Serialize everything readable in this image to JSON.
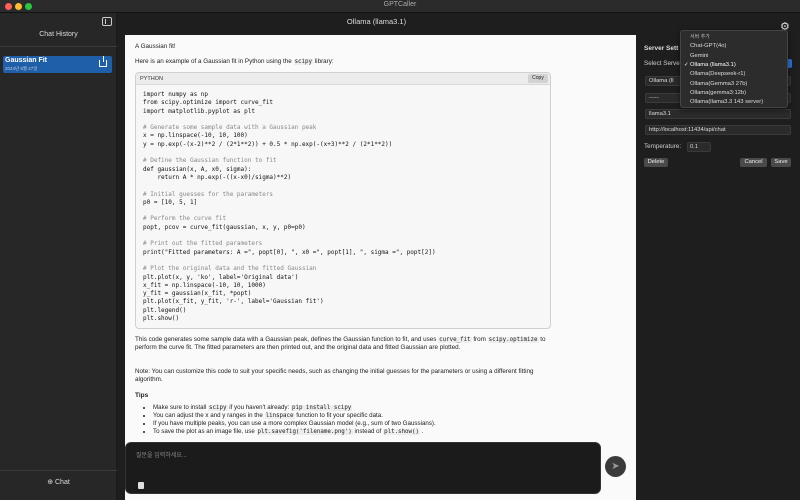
{
  "window": {
    "title": "GPTCaller"
  },
  "sidebar": {
    "title": "Chat History",
    "items": [
      {
        "title": "Gaussian Fit",
        "subtitle": "2024년 9월 27일"
      }
    ],
    "chat_button": "Chat"
  },
  "header": {
    "model_title": "Ollama (llama3.1)"
  },
  "message": {
    "user_prompt": "A Gaussian fit!",
    "intro_before": "Here is an example of a Gaussian fit in Python using the",
    "intro_code": "scipy",
    "intro_after": "library:",
    "code": {
      "language": "PYTHON",
      "copy_label": "Copy",
      "lines": [
        "import numpy as np",
        "from scipy.optimize import curve_fit",
        "import matplotlib.pyplot as plt",
        "",
        "# Generate some sample data with a Gaussian peak",
        "x = np.linspace(-10, 10, 100)",
        "y = np.exp(-(x-2)**2 / (2*1**2)) + 0.5 * np.exp(-(x+3)**2 / (2*1**2))",
        "",
        "# Define the Gaussian function to fit",
        "def gaussian(x, A, x0, sigma):",
        "    return A * np.exp(-((x-x0)/sigma)**2)",
        "",
        "# Initial guesses for the parameters",
        "p0 = [10, 5, 1]",
        "",
        "# Perform the curve fit",
        "popt, pcov = curve_fit(gaussian, x, y, p0=p0)",
        "",
        "# Print out the fitted parameters",
        "print(\"Fitted parameters: A =\", popt[0], \", x0 =\", popt[1], \", sigma =\", popt[2])",
        "",
        "# Plot the original data and the fitted Gaussian",
        "plt.plot(x, y, 'ko', label='Original data')",
        "x_fit = np.linspace(-10, 10, 1000)",
        "y_fit = gaussian(x_fit, *popt)",
        "plt.plot(x_fit, y_fit, 'r-', label='Gaussian fit')",
        "plt.legend()",
        "plt.show()"
      ]
    },
    "para1_a": "This code generates some sample data with a Gaussian peak, defines the Gaussian function to fit, and uses",
    "para1_code1": "curve_fit",
    "para1_b": "from",
    "para1_code2": "scipy.optimize",
    "para1_c": "to perform the curve fit. The fitted parameters are then printed out, and the original data and fitted Gaussian are plotted.",
    "para2": "Note: You can customize this code to suit your specific needs, such as changing the initial guesses for the parameters or using a different fitting algorithm.",
    "tips_heading": "Tips",
    "tips": [
      {
        "a": "Make sure to install",
        "code": "scipy",
        "b": "if you haven't already:",
        "code2": "pip install scipy",
        "c": ""
      },
      {
        "a": "You can adjust the x and y ranges in the",
        "code": "linspace",
        "b": "function to fit your specific data.",
        "code2": "",
        "c": ""
      },
      {
        "a": "If you have multiple peaks, you can use a more complex Gaussian model (e.g., sum of two Gaussians).",
        "code": "",
        "b": "",
        "code2": "",
        "c": ""
      },
      {
        "a": "To save the plot as an image file, use",
        "code": "plt.savefig('filename.png')",
        "b": "instead of",
        "code2": "plt.show()",
        "c": "."
      }
    ]
  },
  "input": {
    "placeholder": "질문을 입력하세요..."
  },
  "settings": {
    "title": "Server Sett",
    "select_label": "Select Serve",
    "server_name": "Ollama (ll",
    "api_key": "-----",
    "model": "llama3.1",
    "url": "http://localhost:11434/api/chat",
    "temperature_label": "Temperature:",
    "temperature": "0.1",
    "delete_label": "Delete",
    "cancel_label": "Cancel",
    "save_label": "Save"
  },
  "dropdown": {
    "items": [
      "서버 추가",
      "Chat-GPT(4o)",
      "Gemini",
      "Ollama (llama3.1)",
      "Ollama(Deepseek-r1)",
      "Ollama(Gemma3 27b)",
      "Ollama(gemma3:12b)",
      "Ollama(llama3.3 143 server)"
    ],
    "selected": "Ollama (llama3.1)"
  },
  "colors": {
    "accent": "#1f5ea8",
    "background": "#1e1e1e",
    "content_bg": "#fafafa"
  }
}
